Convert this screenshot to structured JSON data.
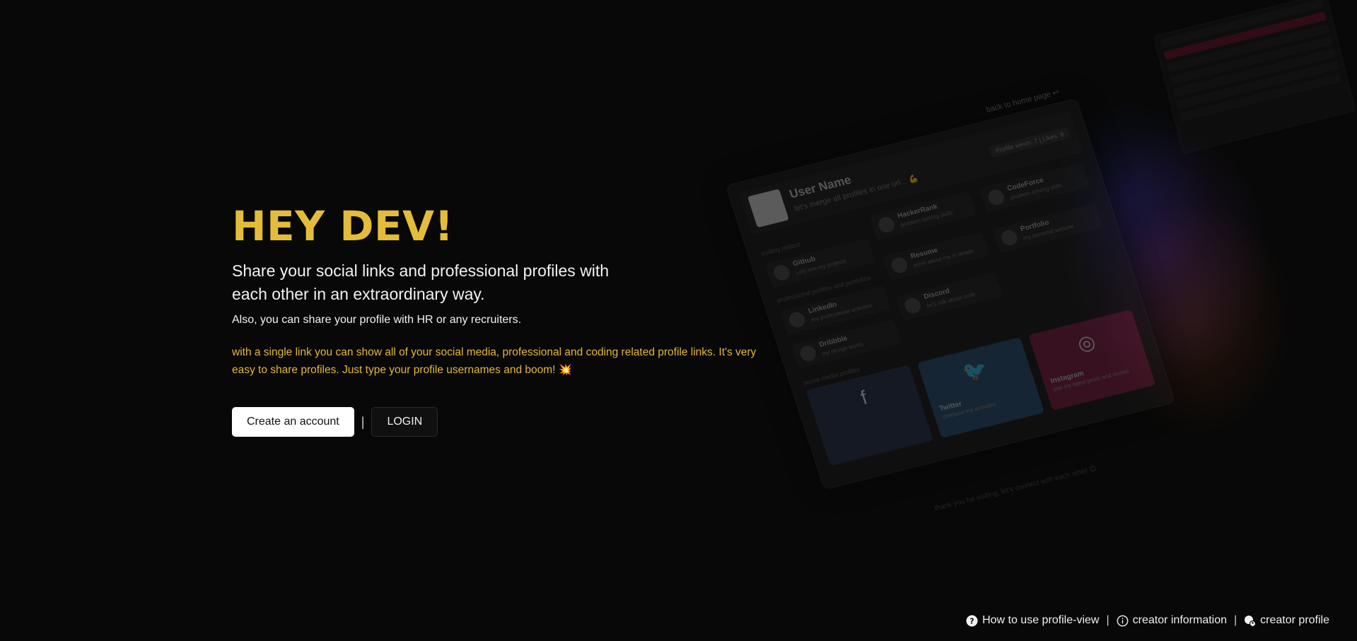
{
  "hero": {
    "title": "HEY DEV!",
    "subtitle": "Share your social links and professional profiles with each other in an extraordinary way.",
    "note": "Also, you can share your profile with HR or any recruiters.",
    "description": "with a single link you can show all of your social media, professional and coding related profile links. It's very easy to share profiles. Just type your profile usernames and boom! 💥"
  },
  "actions": {
    "create_label": "Create an account",
    "separator": "|",
    "login_label": "LOGIN"
  },
  "preview": {
    "back_link": "back to home page ↩",
    "user_name": "User Name",
    "tagline": "let's merge all profiles in one url... 💪",
    "views_badge": "Profile views: 7 | Likes: 8",
    "sections": {
      "coding": "coding related",
      "professional": "professional profiles and portfolios",
      "social": "social media profiles"
    },
    "cards": [
      {
        "title": "HackerRank",
        "sub": "problem solving skills"
      },
      {
        "title": "CodeForce",
        "sub": "problem solving skills"
      },
      {
        "title": "Github",
        "sub": "Lets see my projects"
      },
      {
        "title": "Resume",
        "sub": "more about me in details"
      },
      {
        "title": "Portfolio",
        "sub": "my personal website"
      },
      {
        "title": "LinkedIn",
        "sub": "my professional activities"
      },
      {
        "title": "Discord",
        "sub": "let's talk about code"
      },
      {
        "title": "Dribbble",
        "sub": "my design works"
      }
    ],
    "socials": [
      {
        "title": "",
        "sub": "",
        "icon": "facebook-icon",
        "glyph": "f",
        "color": "#26324a"
      },
      {
        "title": "Twitter",
        "sub": "checkout my activities",
        "icon": "twitter-icon",
        "glyph": "🐦",
        "color": "#2a4f6e"
      },
      {
        "title": "Instagram",
        "sub": "see my latest posts and stories",
        "icon": "instagram-icon",
        "glyph": "◎",
        "color": "#7a1f45"
      }
    ],
    "footer_text": "thank you for visiting, let's connect with each other 😊"
  },
  "footer": {
    "how_to": "How to use profile-view",
    "creator_info": "creator information",
    "creator_profile": "creator profile",
    "separator": "|"
  },
  "colors": {
    "accent": "#e3bd3a",
    "background": "#080808",
    "text": "#f2f2f2"
  }
}
